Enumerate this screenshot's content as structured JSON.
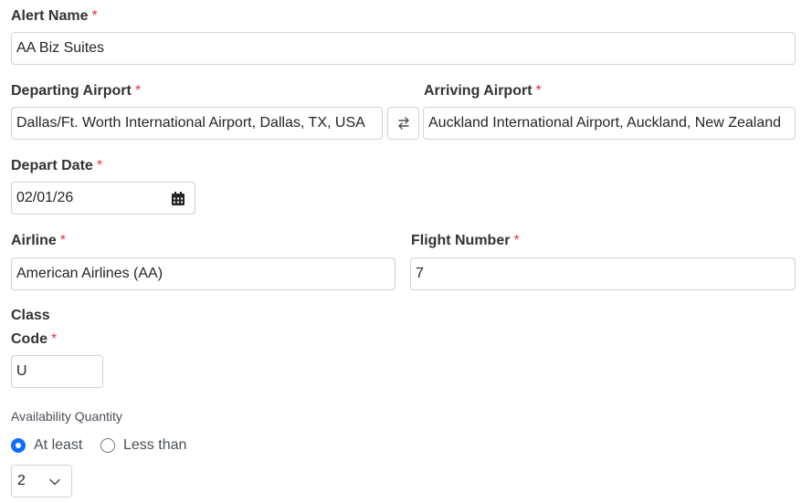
{
  "alert_name": {
    "label": "Alert Name",
    "required": "*",
    "value": "AA Biz Suites"
  },
  "departing_airport": {
    "label": "Departing Airport",
    "required": "*",
    "value": "Dallas/Ft. Worth International Airport, Dallas, TX, USA"
  },
  "arriving_airport": {
    "label": "Arriving Airport",
    "required": "*",
    "value": "Auckland International Airport, Auckland, New Zealand"
  },
  "swap_icon": "swap-arrows-icon",
  "depart_date": {
    "label": "Depart Date",
    "required": "*",
    "value": "02/01/26",
    "icon": "calendar-icon"
  },
  "airline": {
    "label": "Airline",
    "required": "*",
    "value": "American Airlines (AA)"
  },
  "flight_number": {
    "label": "Flight Number",
    "required": "*",
    "value": "7"
  },
  "class_code": {
    "label_line1": "Class",
    "label_line2": "Code",
    "required": "*",
    "value": "U"
  },
  "availability": {
    "label": "Availability Quantity",
    "options": [
      {
        "label": "At least",
        "checked": true
      },
      {
        "label": "Less than",
        "checked": false
      }
    ],
    "quantity": "2",
    "dropdown_icon": "chevron-down-icon"
  },
  "colors": {
    "required": "#dc3545",
    "accent": "#0d6efd",
    "border": "#ced4da"
  }
}
